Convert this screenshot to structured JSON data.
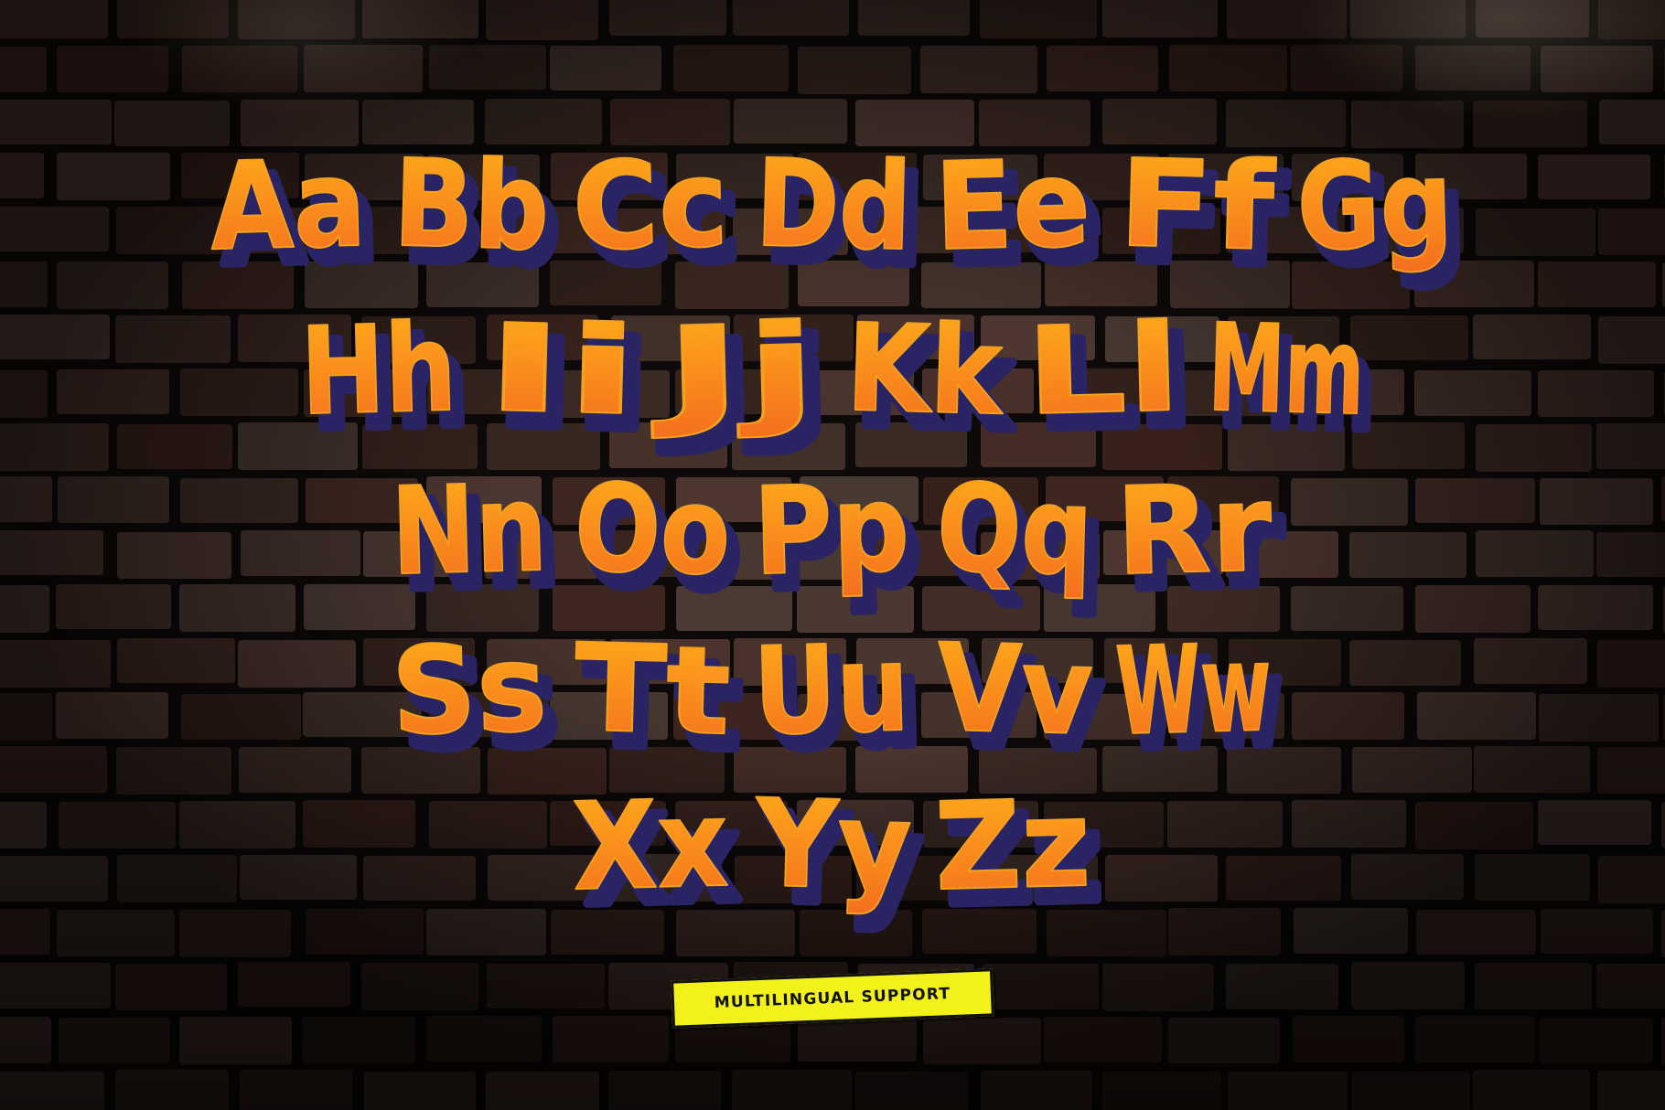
{
  "palette": {
    "letter_top": "#ffae1a",
    "letter_bottom": "#f46d1e",
    "letter_shadow": "#2a2464",
    "badge_fill": "#f2f21a",
    "badge_text": "#111111",
    "brick_mortar": "#0d0a09"
  },
  "alphabet_rows": [
    [
      "Aa",
      "Bb",
      "Cc",
      "Dd",
      "Ee",
      "Ff",
      "Gg"
    ],
    [
      "Hh",
      "Ii",
      "Jj",
      "Kk",
      "Ll",
      "Mm"
    ],
    [
      "Nn",
      "Oo",
      "Pp",
      "Qq",
      "Rr"
    ],
    [
      "Ss",
      "Tt",
      "Uu",
      "Vv",
      "Ww"
    ],
    [
      "Xx",
      "Yy",
      "Zz"
    ]
  ],
  "badge": {
    "label": "MULTILINGUAL SUPPORT"
  }
}
